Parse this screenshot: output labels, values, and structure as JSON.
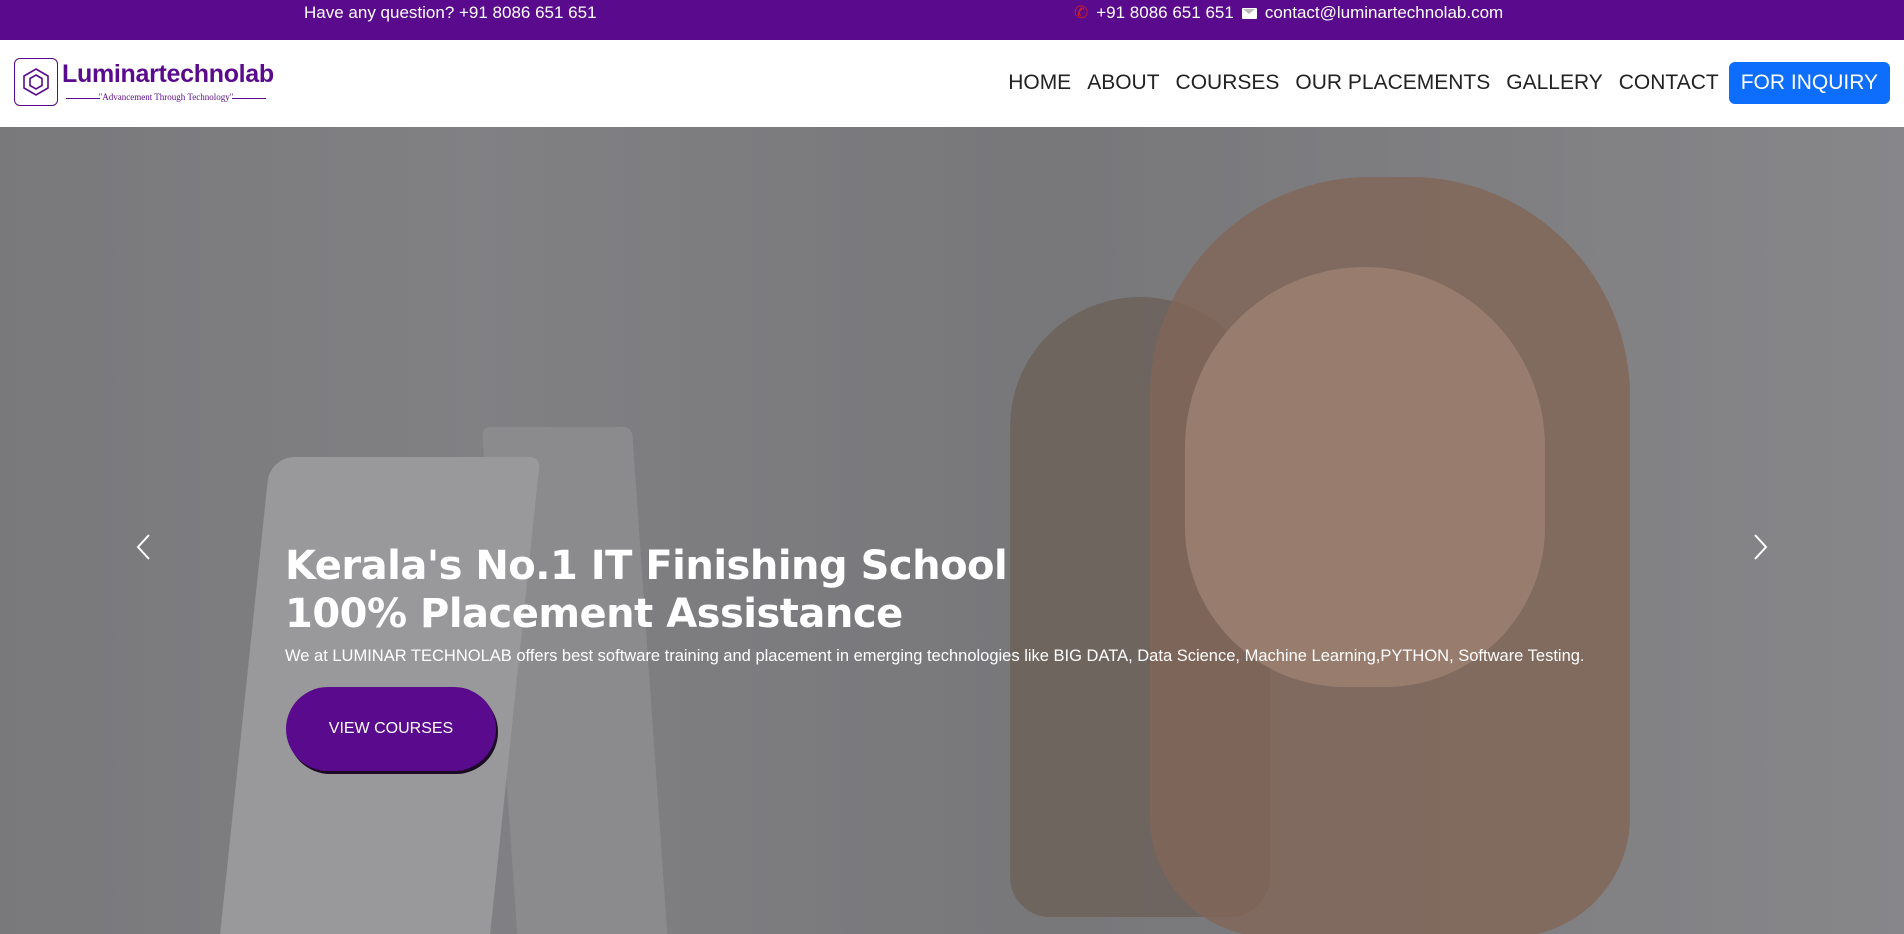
{
  "topbar": {
    "question": "Have any question? +91 8086 651 651",
    "phone_icon": "phone-icon",
    "phone": "+91 8086 651 651",
    "mail_icon": "mail-icon",
    "email": "contact@luminartechnolab.com",
    "background": "#5a0a8c"
  },
  "navbar": {
    "logo_name": "Luminartechnolab",
    "logo_tagline": "\"Advancement Through Technology\"",
    "items": [
      "HOME",
      "ABOUT",
      "COURSES",
      "OUR PLACEMENTS",
      "GALLERY",
      "CONTACT"
    ],
    "inquiry": "FOR INQUIRY",
    "inquiry_color": "#0d6efd"
  },
  "hero": {
    "heading_line1": "Kerala's No.1 IT Finishing School",
    "heading_line2": "100% Placement Assistance",
    "description": "We at LUMINAR TECHNOLAB offers best software training and placement in emerging technologies like BIG DATA, Data Science, Machine Learning,PYTHON, Software Testing.",
    "cta": "VIEW COURSES",
    "prev_icon": "chevron-left-icon",
    "next_icon": "chevron-right-icon",
    "accent": "#5a0a8c"
  }
}
